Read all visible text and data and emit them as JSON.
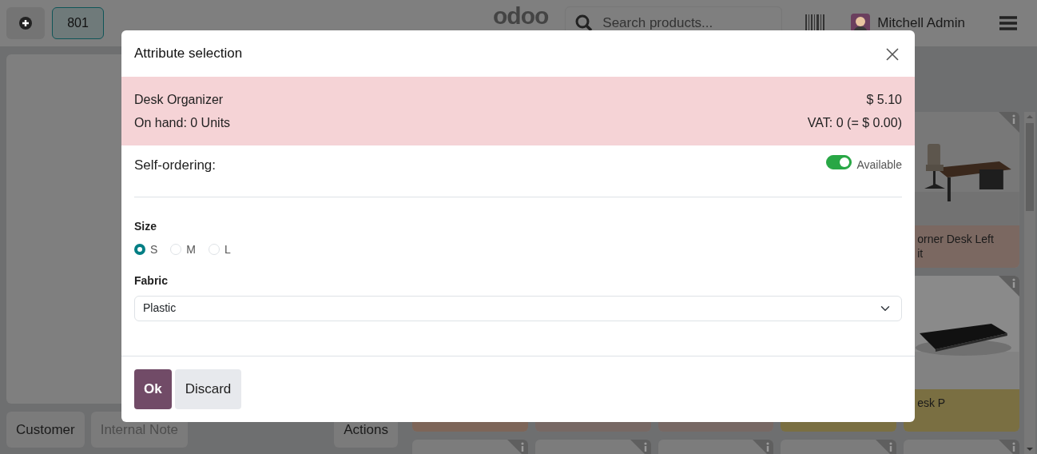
{
  "topbar": {
    "order_number": "801",
    "logo": "odoo",
    "search": {
      "placeholder": "Search products..."
    },
    "user": "Mitchell Admin"
  },
  "left_buttons": [
    {
      "label": "Customer",
      "disabled": false
    },
    {
      "label": "Internal Note",
      "disabled": true
    },
    {
      "label": "Actions",
      "disabled": false
    }
  ],
  "product_rows": [
    [
      null,
      null,
      null,
      null,
      {
        "kind": "picture",
        "name_lines": [
          "orner Desk Left",
          "it"
        ],
        "color": "#7b6861"
      }
    ],
    [
      {
        "kind": "strip",
        "color": "#7d6558"
      },
      {
        "kind": "strip",
        "color": "#776864"
      },
      {
        "kind": "strip",
        "color": "#776864"
      },
      {
        "kind": "strip",
        "color": "#7a6f42"
      },
      {
        "kind": "picture",
        "name_lines": [
          "esk P"
        ],
        "color": "#7a6f42"
      }
    ],
    [
      {
        "kind": "blank"
      },
      {
        "kind": "blank"
      },
      {
        "kind": "blank"
      },
      {
        "kind": "blank"
      },
      {
        "kind": "blank"
      }
    ]
  ],
  "dialog": {
    "title": "Attribute selection",
    "product": {
      "name": "Desk Organizer",
      "price": "$ 5.10",
      "on_hand": "On hand: 0 Units",
      "vat": "VAT: 0 (= $ 0.00)"
    },
    "self_ordering": {
      "label": "Self-ordering:",
      "on": true,
      "text": "Available"
    },
    "attributes": [
      {
        "kind": "radio",
        "name": "Size",
        "options": [
          {
            "label": "S",
            "selected": true
          },
          {
            "label": "M",
            "selected": false
          },
          {
            "label": "L",
            "selected": false
          }
        ]
      },
      {
        "kind": "select",
        "name": "Fabric",
        "value": "Plastic"
      }
    ],
    "buttons": [
      {
        "label": "Ok",
        "kind": "primary"
      },
      {
        "label": "Discard",
        "kind": "secondary"
      }
    ]
  }
}
